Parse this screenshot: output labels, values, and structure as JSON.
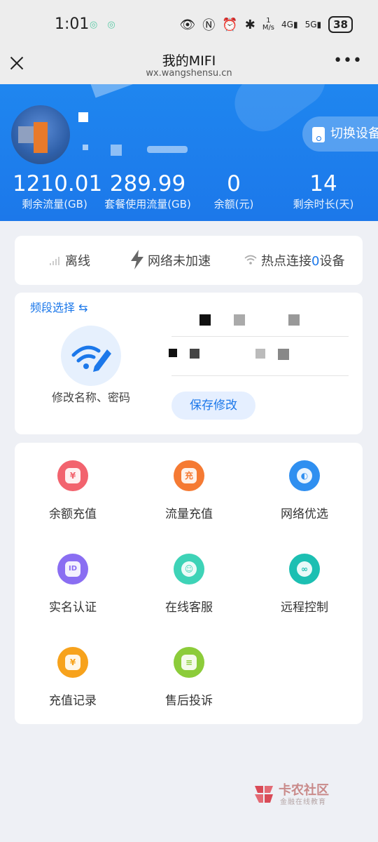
{
  "status_bar": {
    "time": "1:01",
    "net_speed_top": "1",
    "net_speed_bottom": "M/s",
    "signal1": "4G",
    "signal2": "5G",
    "battery": "38"
  },
  "titlebar": {
    "title": "我的MIFI",
    "subtitle": "wx.wangshensu.cn",
    "more": "•••"
  },
  "hero": {
    "switch_label": "切换设备",
    "stats": [
      {
        "value": "1210.01",
        "label": "剩余流量(GB)"
      },
      {
        "value": "289.99",
        "label": "套餐使用流量(GB)"
      },
      {
        "value": "0",
        "label": "余额(元)"
      },
      {
        "value": "14",
        "label": "剩余时长(天)"
      }
    ]
  },
  "status_card": {
    "offline": "离线",
    "accel": "网络未加速",
    "hotspot_prefix": "热点连接",
    "hotspot_count": "0",
    "hotspot_suffix": "设备"
  },
  "band_card": {
    "band_label": "频段选择 ⇆",
    "edit_label": "修改名称、密码",
    "save_button": "保存修改"
  },
  "grid": [
    {
      "label": "余额充值",
      "icon": "balance-recharge-icon",
      "color": "#f2636e",
      "glyph": "¥"
    },
    {
      "label": "流量充值",
      "icon": "data-recharge-icon",
      "color": "#f57a33",
      "glyph": "充"
    },
    {
      "label": "网络优选",
      "icon": "network-optimize-icon",
      "color": "#2f8ff0",
      "glyph": "◐"
    },
    {
      "label": "实名认证",
      "icon": "real-name-icon",
      "color": "#8a6ef2",
      "glyph": "ID"
    },
    {
      "label": "在线客服",
      "icon": "customer-service-icon",
      "color": "#3ed3b7",
      "glyph": "☺"
    },
    {
      "label": "远程控制",
      "icon": "remote-control-icon",
      "color": "#1cbfb2",
      "glyph": "∞"
    },
    {
      "label": "充值记录",
      "icon": "recharge-record-icon",
      "color": "#f7a21c",
      "glyph": "¥"
    },
    {
      "label": "售后投诉",
      "icon": "complaint-icon",
      "color": "#8ccc3a",
      "glyph": "≡"
    }
  ],
  "watermark": {
    "name": "卡农社区",
    "sub": "金融在线教育"
  },
  "colors": {
    "primary": "#1c78ea",
    "background": "#eef0f5"
  }
}
